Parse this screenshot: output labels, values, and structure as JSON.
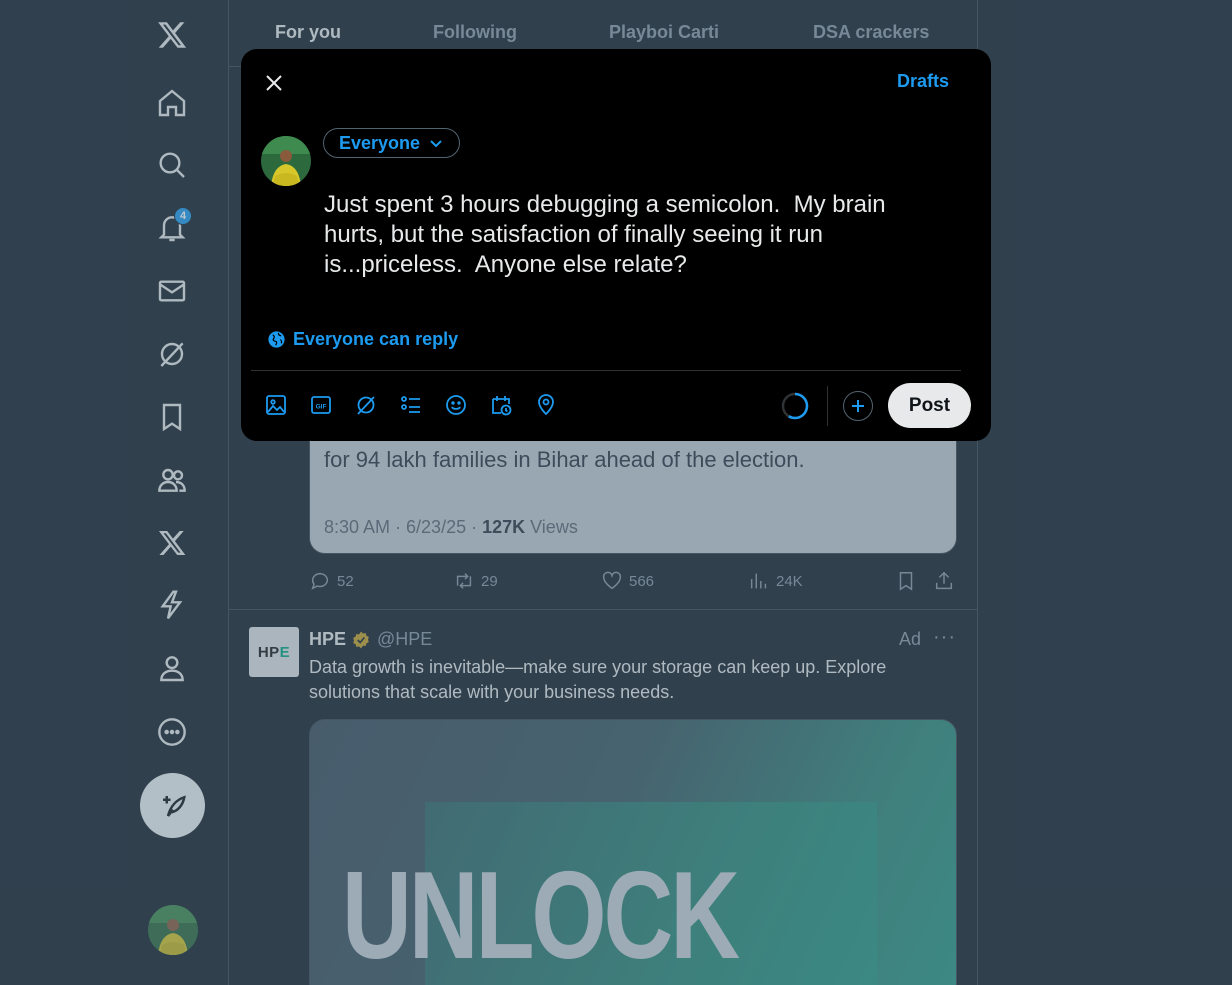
{
  "tabs": [
    {
      "label": "For you",
      "active": true
    },
    {
      "label": "Following",
      "active": false
    },
    {
      "label": "Playboi Carti",
      "active": false
    },
    {
      "label": "DSA crackers",
      "active": false
    }
  ],
  "nav": {
    "items": [
      {
        "name": "x-logo-icon"
      },
      {
        "name": "home-icon"
      },
      {
        "name": "search-icon"
      },
      {
        "name": "notifications-icon",
        "badge": "4"
      },
      {
        "name": "messages-icon"
      },
      {
        "name": "grok-icon"
      },
      {
        "name": "bookmarks-icon"
      },
      {
        "name": "communities-icon"
      },
      {
        "name": "premium-icon"
      },
      {
        "name": "verified-orgs-icon"
      },
      {
        "name": "profile-icon"
      },
      {
        "name": "more-icon"
      }
    ],
    "compose_icon": "feather-plus-icon"
  },
  "feed": {
    "quoted_post": {
      "text": "for 94 lakh families in Bihar ahead of the election.",
      "time": "8:30 AM · 6/23/25 · ",
      "views_count": "127K",
      "views_label": " Views"
    },
    "post_actions": {
      "replies": "52",
      "reposts": "29",
      "likes": "566",
      "views": "24K"
    },
    "ad": {
      "logo_text_main": "HP",
      "logo_text_accent": "E",
      "name": "HPE",
      "handle": "@HPE",
      "tag": "Ad",
      "more": "···",
      "text": "Data growth is inevitable—make sure your storage can keep up. Explore solutions that scale with your business needs.",
      "media_headline": "UNLOCK"
    }
  },
  "composer": {
    "drafts_label": "Drafts",
    "audience_label": "Everyone",
    "post_text": "Just spent 3 hours debugging a semicolon.  My brain hurts, but the satisfaction of finally seeing it run is...priceless.  Anyone else relate?",
    "reply_setting": "Everyone can reply",
    "post_button": "Post",
    "accent_color": "#1d9bf0",
    "toolbar_icons": [
      "image-icon",
      "gif-icon",
      "grok-icon",
      "poll-icon",
      "emoji-icon",
      "schedule-icon",
      "location-icon"
    ]
  }
}
